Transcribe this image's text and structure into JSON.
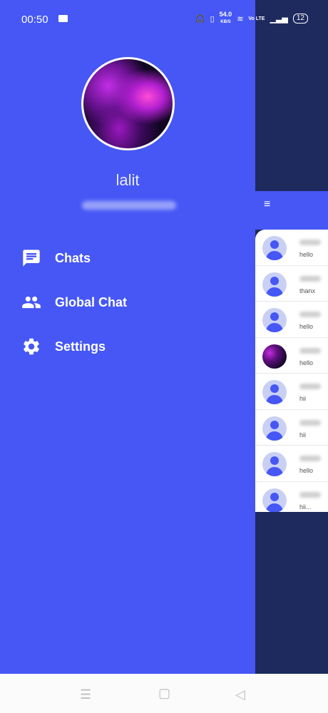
{
  "status_bar": {
    "time": "00:50",
    "speed": "54.0",
    "speed_unit": "KB/S",
    "network": "Vo LTE",
    "battery": "12"
  },
  "drawer": {
    "user_name": "lalit",
    "menu": [
      {
        "label": "Chats",
        "icon": "chat-icon"
      },
      {
        "label": "Global Chat",
        "icon": "people-icon"
      },
      {
        "label": "Settings",
        "icon": "gear-icon"
      }
    ]
  },
  "chat_list": {
    "menu_icon": "≡",
    "items": [
      {
        "message": "hello",
        "avatar": "default"
      },
      {
        "message": "thanx",
        "avatar": "default"
      },
      {
        "message": "hello",
        "avatar": "default"
      },
      {
        "message": "hello",
        "avatar": "image"
      },
      {
        "message": "hii",
        "avatar": "default"
      },
      {
        "message": "hii",
        "avatar": "default"
      },
      {
        "message": "hello",
        "avatar": "default"
      },
      {
        "message": "hii...",
        "avatar": "default"
      }
    ]
  },
  "colors": {
    "drawer_bg": "#4657f5",
    "background": "#1e2a5e",
    "accent_light": "#c9d0f6"
  }
}
